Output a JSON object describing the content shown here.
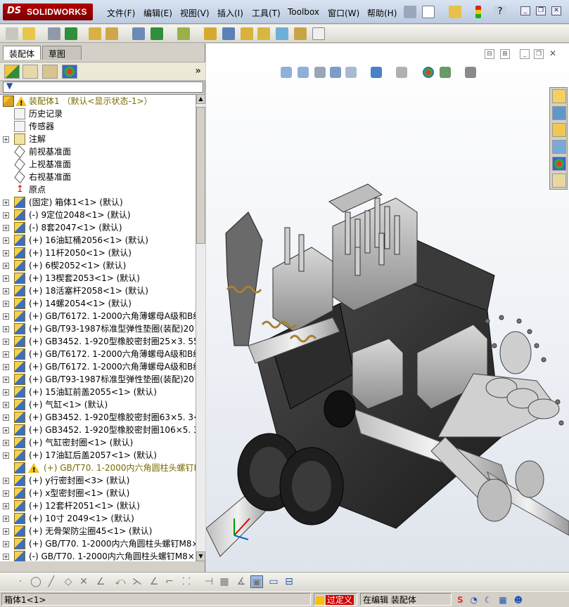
{
  "app": {
    "brand_prefix": "DS",
    "brand_name": "SOLIDWORKS"
  },
  "menu": [
    "文件(F)",
    "编辑(E)",
    "视图(V)",
    "插入(I)",
    "工具(T)",
    "Toolbox",
    "窗口(W)",
    "帮助(H)"
  ],
  "panel_tabs": {
    "assembly": "装配体",
    "sketch": "草图"
  },
  "tree": {
    "root": "装配体1 （默认<显示状态-1>）",
    "items": [
      {
        "label": "历史记录",
        "kind": "history",
        "expandable": false
      },
      {
        "label": "传感器",
        "kind": "sensor",
        "expandable": false
      },
      {
        "label": "注解",
        "kind": "annotation",
        "expandable": true
      },
      {
        "label": "前视基准面",
        "kind": "plane",
        "expandable": false
      },
      {
        "label": "上视基准面",
        "kind": "plane",
        "expandable": false
      },
      {
        "label": "右视基准面",
        "kind": "plane",
        "expandable": false
      },
      {
        "label": "原点",
        "kind": "origin",
        "expandable": false
      },
      {
        "label": "(固定) 箱体1<1> (默认)",
        "kind": "part",
        "expandable": true
      },
      {
        "label": "(-) 9定位2048<1> (默认)",
        "kind": "part",
        "expandable": true
      },
      {
        "label": "(-) 8套2047<1> (默认)",
        "kind": "part",
        "expandable": true
      },
      {
        "label": "(+) 16油缸桶2056<1> (默认)",
        "kind": "part",
        "expandable": true
      },
      {
        "label": "(+) 11杆2050<1> (默认)",
        "kind": "part",
        "expandable": true
      },
      {
        "label": "(+) 6楔2052<1> (默认)",
        "kind": "part",
        "expandable": true
      },
      {
        "label": "(+) 13楔套2053<1> (默认)",
        "kind": "part",
        "expandable": true
      },
      {
        "label": "(+) 18活塞杆2058<1> (默认)",
        "kind": "part",
        "expandable": true
      },
      {
        "label": "(+) 14螺2054<1> (默认)",
        "kind": "part",
        "expandable": true
      },
      {
        "label": "(+) GB/T6172. 1-2000六角薄螺母A级和B级",
        "kind": "part",
        "expandable": true
      },
      {
        "label": "(+) GB/T93-1987标准型弹性垫圈(装配)20",
        "kind": "part",
        "expandable": true
      },
      {
        "label": "(+) GB3452. 1-920型橡胶密封圈25×3. 55<",
        "kind": "part",
        "expandable": true
      },
      {
        "label": "(+) GB/T6172. 1-2000六角薄螺母A级和B级",
        "kind": "part",
        "expandable": true
      },
      {
        "label": "(+) GB/T6172. 1-2000六角薄螺母A级和B级",
        "kind": "part",
        "expandable": true
      },
      {
        "label": "(+) GB/T93-1987标准型弹性垫圈(装配)20",
        "kind": "part",
        "expandable": true
      },
      {
        "label": "(+) 15油缸前盖2055<1> (默认)",
        "kind": "part",
        "expandable": true
      },
      {
        "label": "(+) 气缸<1> (默认)",
        "kind": "part",
        "expandable": true
      },
      {
        "label": "(+) GB3452. 1-920型橡胶密封圈63×5. 3<1",
        "kind": "part",
        "expandable": true
      },
      {
        "label": "(+) GB3452. 1-920型橡胶密封圈106×5. 3<",
        "kind": "part",
        "expandable": true
      },
      {
        "label": "(+) 气缸密封圈<1> (默认)",
        "kind": "part",
        "expandable": true
      },
      {
        "label": "(+) 17油缸后盖2057<1> (默认)",
        "kind": "part",
        "expandable": true
      },
      {
        "label": "(+) GB/T70. 1-2000内六角圆柱头螺钉M",
        "kind": "warning",
        "expandable": false
      },
      {
        "label": "(+) y行密封圈<3> (默认)",
        "kind": "part",
        "expandable": true
      },
      {
        "label": "(+) x型密封圈<1> (默认)",
        "kind": "part",
        "expandable": true
      },
      {
        "label": "(+) 12套杆2051<1> (默认)",
        "kind": "part",
        "expandable": true
      },
      {
        "label": "(+) 10寸 2049<1> (默认)",
        "kind": "part",
        "expandable": true
      },
      {
        "label": "(+) 无骨架防尘圈45<1> (默认)",
        "kind": "part",
        "expandable": true
      },
      {
        "label": "(+) GB/T70. 1-2000内六角圆柱头螺钉M8×",
        "kind": "part",
        "expandable": true
      },
      {
        "label": "(-) GB/T70. 1-2000内六角圆柱头螺钉M8×",
        "kind": "part",
        "expandable": true
      }
    ]
  },
  "status": {
    "selection": "箱体1<1>",
    "over_defined": "过定义",
    "editing": "在编辑 装配体"
  },
  "colors": {
    "warning": "#f3c10e",
    "over_defined_bg": "#d40000",
    "model_dark": "#2b2b2b",
    "model_light": "#cfcfcf"
  },
  "icons": {
    "taskpane": [
      "home-icon",
      "design-library-icon",
      "file-explorer-icon",
      "view-palette-icon",
      "appearance-icon",
      "custom-properties-icon"
    ],
    "headsup": [
      "zoom-to-fit-icon",
      "zoom-area-icon",
      "previous-view-icon",
      "section-view-icon",
      "view-orientation-icon",
      "display-style-icon",
      "hide-show-icon",
      "edit-appearance-icon",
      "apply-scene-icon",
      "view-settings-icon"
    ]
  }
}
